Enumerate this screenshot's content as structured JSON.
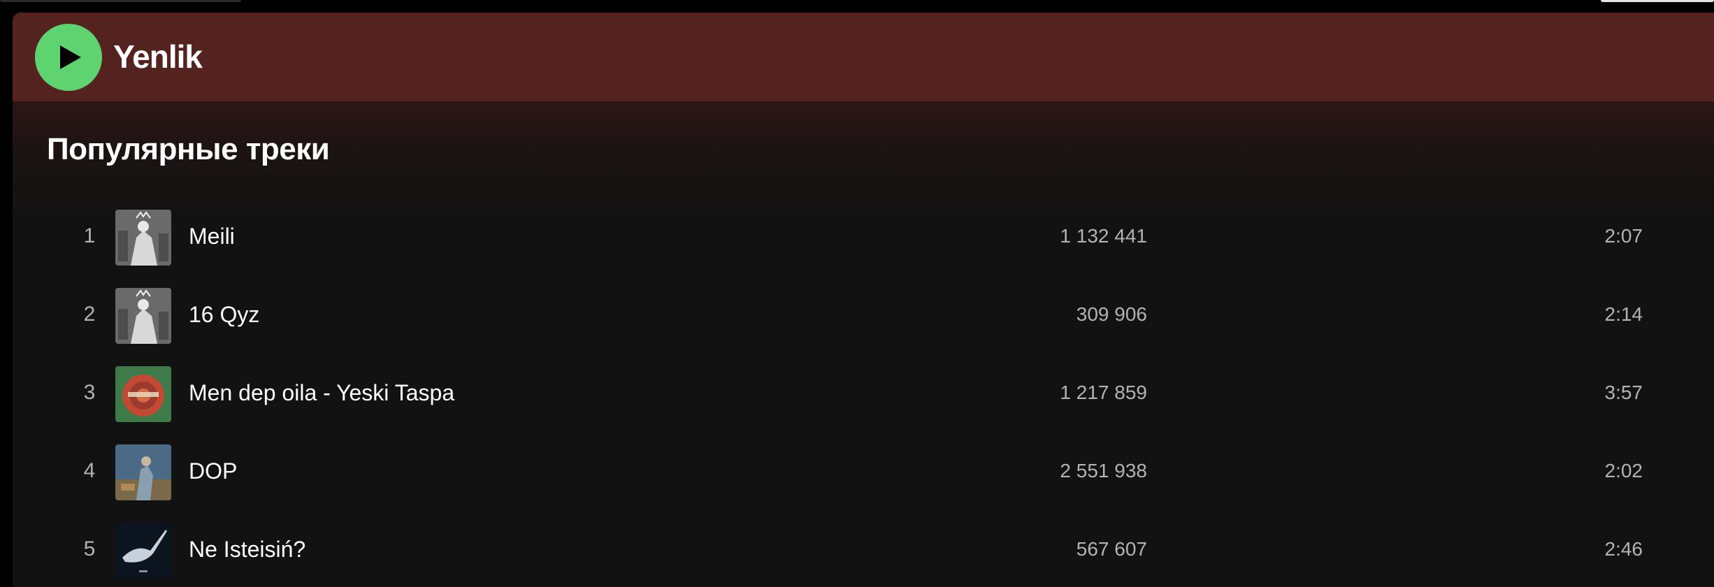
{
  "artist": {
    "name": "Yenlik"
  },
  "popular": {
    "title": "Популярные треки",
    "tracks": [
      {
        "index": "1",
        "title": "Meili",
        "plays": "1 132 441",
        "duration": "2:07",
        "cover_icon": "album-cover-bw"
      },
      {
        "index": "2",
        "title": "16 Qyz",
        "plays": "309 906",
        "duration": "2:14",
        "cover_icon": "album-cover-bw"
      },
      {
        "index": "3",
        "title": "Men dep oila - Yeski Taspa",
        "plays": "1 217 859",
        "duration": "3:57",
        "cover_icon": "album-cover-green-red"
      },
      {
        "index": "4",
        "title": "DOP",
        "plays": "2 551 938",
        "duration": "2:02",
        "cover_icon": "album-cover-blue-figure"
      },
      {
        "index": "5",
        "title": "Ne Isteisiń?",
        "plays": "567 607",
        "duration": "2:46",
        "cover_icon": "album-cover-dark"
      }
    ]
  },
  "colors": {
    "header_bg": "#54221f",
    "play_button": "#5fd36f",
    "panel_bg": "#121212",
    "secondary_text": "#b3b3b3"
  }
}
